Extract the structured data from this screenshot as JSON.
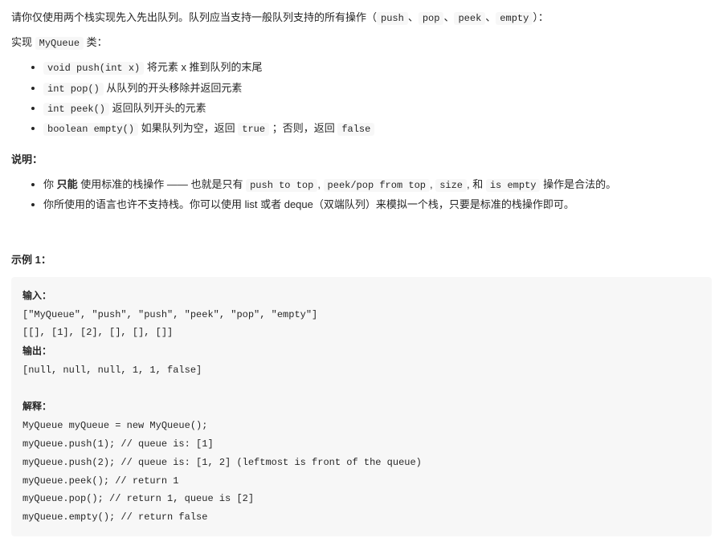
{
  "intro": {
    "line1_pre": "请你仅使用两个栈实现先入先出队列。队列应当支持一般队列支持的所有操作（",
    "op_push": "push",
    "sep": "、",
    "op_pop": "pop",
    "op_peek": "peek",
    "op_empty": "empty",
    "line1_post": "）：",
    "line2_pre": "实现 ",
    "class_name": "MyQueue",
    "line2_post": " 类：",
    "bullets": [
      {
        "code": "void push(int x)",
        "desc": " 将元素 x 推到队列的末尾"
      },
      {
        "code": "int pop()",
        "desc": " 从队列的开头移除并返回元素"
      },
      {
        "code": "int peek()",
        "desc": " 返回队列开头的元素"
      }
    ],
    "empty_bullet": {
      "code": "boolean empty()",
      "d1": " 如果队列为空，返回 ",
      "true": "true",
      "d2": " ；否则，返回 ",
      "false": "false"
    }
  },
  "notes": {
    "heading": "说明：",
    "b1": {
      "p1": "你 ",
      "strong": "只能",
      "p2": " 使用标准的栈操作 —— 也就是只有 ",
      "c1": "push to top",
      "s": ", ",
      "c2": "peek/pop from top",
      "c3": "size",
      "p3": ", 和 ",
      "c4": "is empty",
      "p4": " 操作是合法的。"
    },
    "b2": "你所使用的语言也许不支持栈。你可以使用 list 或者 deque（双端队列）来模拟一个栈，只要是标准的栈操作即可。"
  },
  "example": {
    "heading": "示例 1：",
    "label_input": "输入：",
    "input_l1": "[\"MyQueue\", \"push\", \"push\", \"peek\", \"pop\", \"empty\"]",
    "input_l2": "[[], [1], [2], [], [], []]",
    "label_output": "输出：",
    "output_l1": "[null, null, null, 1, 1, false]",
    "label_explain": "解释：",
    "ex_l1": "MyQueue myQueue = new MyQueue();",
    "ex_l2": "myQueue.push(1); // queue is: [1]",
    "ex_l3": "myQueue.push(2); // queue is: [1, 2] (leftmost is front of the queue)",
    "ex_l4": "myQueue.peek(); // return 1",
    "ex_l5": "myQueue.pop(); // return 1, queue is [2]",
    "ex_l6": "myQueue.empty(); // return false"
  }
}
